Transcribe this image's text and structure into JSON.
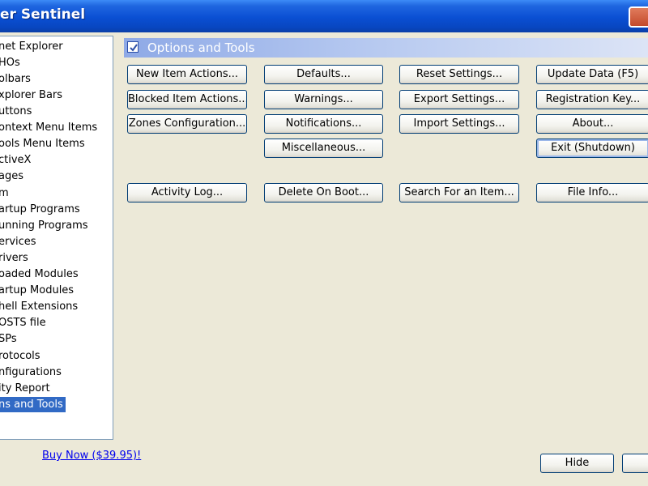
{
  "window": {
    "title": "er Sentinel"
  },
  "tree": {
    "items": [
      "net Explorer",
      "HOs",
      "olbars",
      "xplorer Bars",
      "uttons",
      "ontext Menu Items",
      "ools Menu Items",
      "ctiveX",
      "ages",
      "m",
      "artup Programs",
      "unning Programs",
      "ervices",
      "rivers",
      "oaded Modules",
      "artup Modules",
      "hell Extensions",
      "OSTS file",
      "SPs",
      "rotocols",
      "nfigurations",
      "ity Report",
      "ns and Tools"
    ],
    "selected_index": 22
  },
  "section": {
    "title": "Options and Tools"
  },
  "buttons": {
    "new_item_actions": "New Item Actions...",
    "blocked_item_actions": "Blocked Item Actions...",
    "zones_configuration": "Zones Configuration...",
    "activity_log": "Activity Log...",
    "defaults": "Defaults...",
    "warnings": "Warnings...",
    "notifications": "Notifications...",
    "miscellaneous": "Miscellaneous...",
    "delete_on_boot": "Delete On Boot...",
    "reset_settings": "Reset Settings...",
    "export_settings": "Export Settings...",
    "import_settings": "Import Settings...",
    "search_for_item": "Search For an Item...",
    "update_data": "Update Data (F5)",
    "registration_key": "Registration Key...",
    "about": "About...",
    "exit": "Exit (Shutdown)",
    "file_info": "File Info..."
  },
  "footer": {
    "buy_now": "Buy Now ($39.95)!",
    "hide": "Hide"
  },
  "colors": {
    "selection": "#316AC5",
    "link": "#0000EE",
    "dialog_bg": "#ECE9D8"
  }
}
